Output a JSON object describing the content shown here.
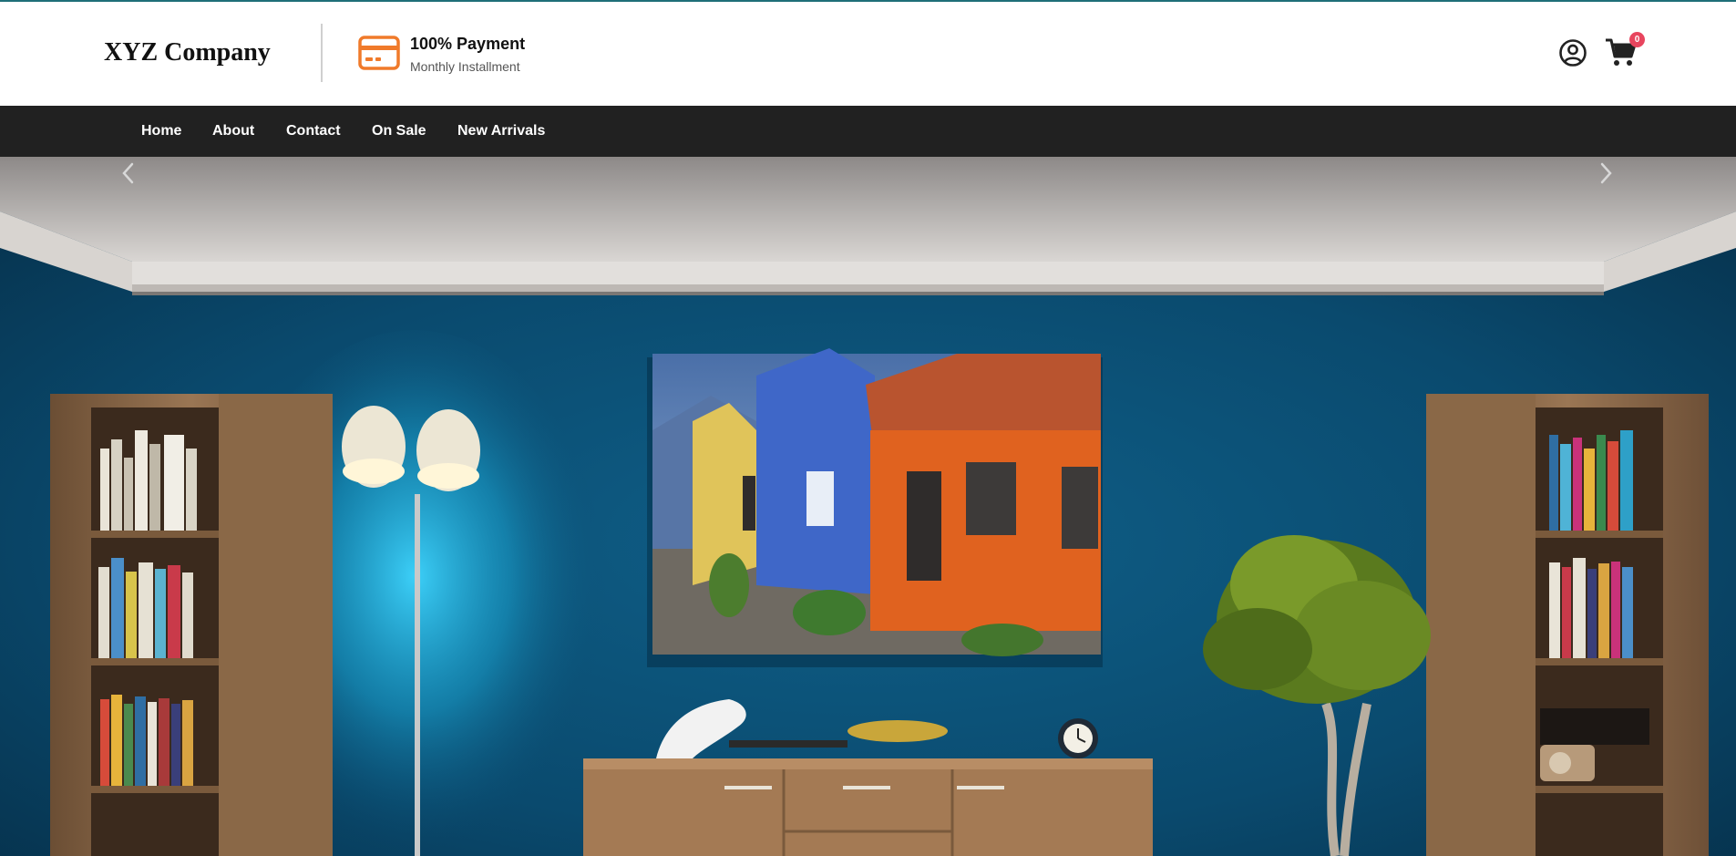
{
  "header": {
    "logo": "XYZ Company",
    "payment_title": "100% Payment",
    "payment_subtitle": "Monthly Installment",
    "cart_count": "0",
    "accent_color": "#f07a2a",
    "badge_color": "#e8455e"
  },
  "nav": {
    "items": [
      {
        "label": "Home"
      },
      {
        "label": "About"
      },
      {
        "label": "Contact"
      },
      {
        "label": "On Sale"
      },
      {
        "label": "New Arrivals"
      }
    ]
  },
  "hero": {
    "slider_prev_icon": "chevron-left-icon",
    "slider_next_icon": "chevron-right-icon"
  }
}
